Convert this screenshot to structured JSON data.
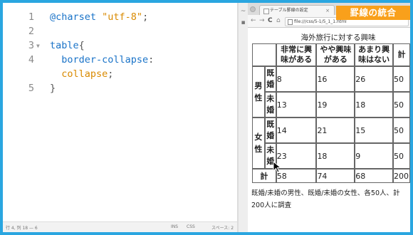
{
  "editor": {
    "lines": [
      {
        "num": "1",
        "parts": [
          {
            "t": "@charset ",
            "c": "kw"
          },
          {
            "t": "\"utf-8\"",
            "c": "str"
          },
          {
            "t": ";",
            "c": "punc"
          }
        ]
      },
      {
        "num": "2",
        "parts": []
      },
      {
        "num": "3",
        "fold": true,
        "parts": [
          {
            "t": "table",
            "c": "kw"
          },
          {
            "t": "{",
            "c": "punc"
          }
        ]
      },
      {
        "num": "4",
        "parts": [
          {
            "t": "  border-collapse",
            "c": "prop"
          },
          {
            "t": ":",
            "c": "punc"
          }
        ]
      },
      {
        "num": "",
        "parts": [
          {
            "t": "  collapse",
            "c": "val"
          },
          {
            "t": ";",
            "c": "punc"
          }
        ]
      },
      {
        "num": "5",
        "parts": [
          {
            "t": "}",
            "c": "punc"
          }
        ]
      }
    ],
    "status": {
      "position": "行 4, 列 18 — 6",
      "ins": "INS",
      "mode": "CSS",
      "spaces": "スペース: 2"
    }
  },
  "browser": {
    "tab_title": "テーブル罫線の設定",
    "tab_close": "×",
    "url": "file:///css/5-1/5_1_1.html",
    "nav": {
      "back": "←",
      "forward": "→",
      "reload": "C",
      "home": "⌂"
    },
    "banner": "罫線の統合",
    "page": {
      "caption": "海外旅行に対する興味",
      "headers": [
        "非常に興味がある",
        "やや興味がある",
        "あまり興味はない",
        "計"
      ],
      "groups": [
        {
          "label": "男性",
          "rows": [
            {
              "sub": "既婚",
              "values": [
                "8",
                "16",
                "26",
                "50"
              ]
            },
            {
              "sub": "未婚",
              "values": [
                "13",
                "19",
                "18",
                "50"
              ]
            }
          ]
        },
        {
          "label": "女性",
          "rows": [
            {
              "sub": "既婚",
              "values": [
                "14",
                "21",
                "15",
                "50"
              ]
            },
            {
              "sub": "未婚",
              "values": [
                "23",
                "18",
                "9",
                "50"
              ]
            }
          ]
        }
      ],
      "total": {
        "label": "計",
        "values": [
          "58",
          "74",
          "68",
          "200"
        ]
      },
      "note": "既婚/未婚の男性、既婚/未婚の女性、各50人、計200人に調査"
    }
  }
}
